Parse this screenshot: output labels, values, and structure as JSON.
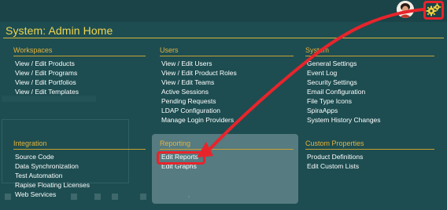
{
  "page_title": "System: Admin Home",
  "panels": {
    "workspaces": {
      "title": "Workspaces",
      "items": [
        "View / Edit Products",
        "View / Edit Programs",
        "View / Edit Portfolios",
        "View / Edit Templates"
      ]
    },
    "users": {
      "title": "Users",
      "items": [
        "View / Edit Users",
        "View / Edit Product Roles",
        "View / Edit Teams",
        "Active Sessions",
        "Pending Requests",
        "LDAP Configuration",
        "Manage Login Providers"
      ]
    },
    "system": {
      "title": "System",
      "items": [
        "General Settings",
        "Event Log",
        "Security Settings",
        "Email Configuration",
        "File Type Icons",
        "SpiraApps",
        "System History Changes"
      ]
    },
    "integration": {
      "title": "Integration",
      "items": [
        "Source Code",
        "Data Synchronization",
        "Test Automation",
        "Rapise Floating Licenses",
        "Web Services"
      ]
    },
    "reporting": {
      "title": "Reporting",
      "items": [
        "Edit Reports",
        "Edit Graphs"
      ]
    },
    "custom_properties": {
      "title": "Custom Properties",
      "items": [
        "Product Definitions",
        "Edit Custom Lists"
      ]
    }
  },
  "icons": {
    "avatar": "user-avatar",
    "settings": "gears-icon"
  },
  "colors": {
    "background": "#1d4d51",
    "title": "#f0d54e",
    "section_heading": "#e6b33c",
    "link_text": "#ffffff",
    "annotation": "#e8242b"
  }
}
